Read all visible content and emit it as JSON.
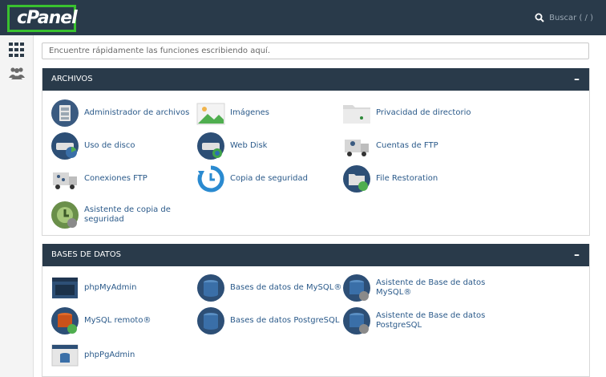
{
  "header": {
    "logo": "cPanel",
    "search_label": "Buscar ( / )"
  },
  "quickfind": {
    "placeholder": "Encuentre rápidamente las funciones escribiendo aquí."
  },
  "sections": [
    {
      "title": "ARCHIVOS",
      "collapse": "–",
      "items": [
        {
          "label": "Administrador de archivos",
          "icon": "file-cabinet-icon"
        },
        {
          "label": "Imágenes",
          "icon": "image-icon"
        },
        {
          "label": "Privacidad de directorio",
          "icon": "folder-privacy-icon"
        },
        {
          "label": "Uso de disco",
          "icon": "disk-usage-icon"
        },
        {
          "label": "Web Disk",
          "icon": "web-disk-icon"
        },
        {
          "label": "Cuentas de FTP",
          "icon": "ftp-accounts-icon"
        },
        {
          "label": "Conexiones FTP",
          "icon": "ftp-connections-icon"
        },
        {
          "label": "Copia de seguridad",
          "icon": "backup-icon"
        },
        {
          "label": "File Restoration",
          "icon": "file-restoration-icon"
        },
        {
          "label": "Asistente de copia de seguridad",
          "icon": "backup-wizard-icon"
        }
      ]
    },
    {
      "title": "BASES DE DATOS",
      "collapse": "–",
      "items": [
        {
          "label": "phpMyAdmin",
          "icon": "phpmyadmin-icon"
        },
        {
          "label": "Bases de datos de MySQL®",
          "icon": "mysql-databases-icon"
        },
        {
          "label": "Asistente de Base de datos MySQL®",
          "icon": "mysql-wizard-icon"
        },
        {
          "label": "MySQL remoto®",
          "icon": "remote-mysql-icon"
        },
        {
          "label": "Bases de datos PostgreSQL",
          "icon": "postgresql-databases-icon"
        },
        {
          "label": "Asistente de Base de datos PostgreSQL",
          "icon": "postgresql-wizard-icon"
        },
        {
          "label": "phpPgAdmin",
          "icon": "phppgadmin-icon"
        }
      ]
    }
  ],
  "colors": {
    "topbar": "#293a4a",
    "logo_highlight": "#39c12f",
    "link": "#2b5a8a"
  }
}
